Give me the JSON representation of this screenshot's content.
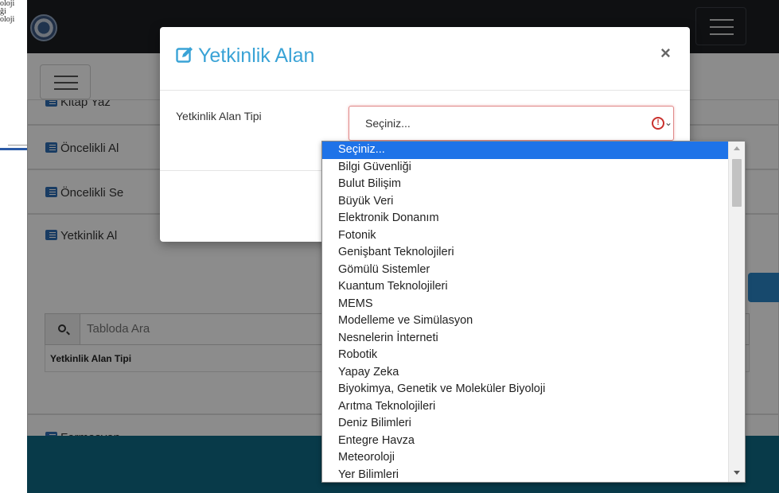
{
  "left_window": {
    "text_lines": [
      "oloji",
      "ği",
      "oloji"
    ]
  },
  "panels": [
    {
      "label": "Kitap Yaz"
    },
    {
      "label": "Öncelikli Al"
    },
    {
      "label": "Öncelikli Se"
    },
    {
      "label": "Yetkinlik Al"
    },
    {
      "label": "Formasyon"
    }
  ],
  "table": {
    "search_placeholder": "Tabloda Ara",
    "column_header": "Yetkinlik Alan Tipi"
  },
  "modal": {
    "title": "Yetkinlik Alan",
    "close_label": "×",
    "field_label": "Yetkinlik Alan Tipi",
    "select_value": "Seçiniz...",
    "warn_glyph": "!"
  },
  "dropdown": {
    "options": [
      "Seçiniz...",
      "Bilgi Güvenliği",
      "Bulut Bilişim",
      "Büyük Veri",
      "Elektronik Donanım",
      "Fotonik",
      "Genişbant Teknolojileri",
      "Gömülü Sistemler",
      "Kuantum Teknolojileri",
      "MEMS",
      "Modelleme ve Simülasyon",
      "Nesnelerin İnterneti",
      "Robotik",
      "Yapay Zeka",
      "Biyokimya, Genetik ve Moleküler Biyoloji",
      "Arıtma Teknolojileri",
      "Deniz Bilimleri",
      "Entegre Havza",
      "Meteoroloji",
      "Yer Bilimleri"
    ],
    "selected_index": 0
  },
  "colors": {
    "accent": "#3aa3d6",
    "selection": "#1e73e8",
    "error": "#c9302c",
    "navbar": "#1c1e22"
  }
}
